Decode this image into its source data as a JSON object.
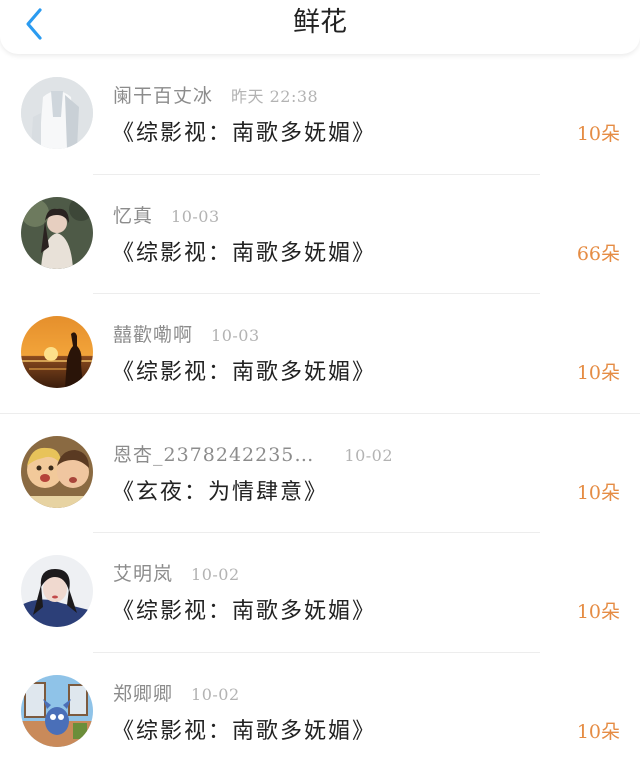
{
  "header": {
    "back_icon": "chevron-left-icon",
    "title": "鲜花"
  },
  "colors": {
    "accent_blue": "#2b9bf0",
    "flower_count": "#e58c44",
    "username": "#8c8c8c",
    "time": "#b3b3b3"
  },
  "items": [
    {
      "username": "阑干百丈冰",
      "time": "昨天 22:38",
      "book": "《综影视：南歌多妩媚》",
      "count": "10朵"
    },
    {
      "username": "忆真",
      "time": "10-03",
      "book": "《综影视：南歌多妩媚》",
      "count": "66朵"
    },
    {
      "username": "囍歡嘞啊",
      "time": "10-03",
      "book": "《综影视：南歌多妩媚》",
      "count": "10朵"
    },
    {
      "username": "恩杏_2378242235…",
      "time": "10-02",
      "book": "《玄夜：为情肆意》",
      "count": "10朵"
    },
    {
      "username": "艾明岚",
      "time": "10-02",
      "book": "《综影视：南歌多妩媚》",
      "count": "10朵"
    },
    {
      "username": "郑卿卿",
      "time": "10-02",
      "book": "《综影视：南歌多妩媚》",
      "count": "10朵"
    }
  ]
}
